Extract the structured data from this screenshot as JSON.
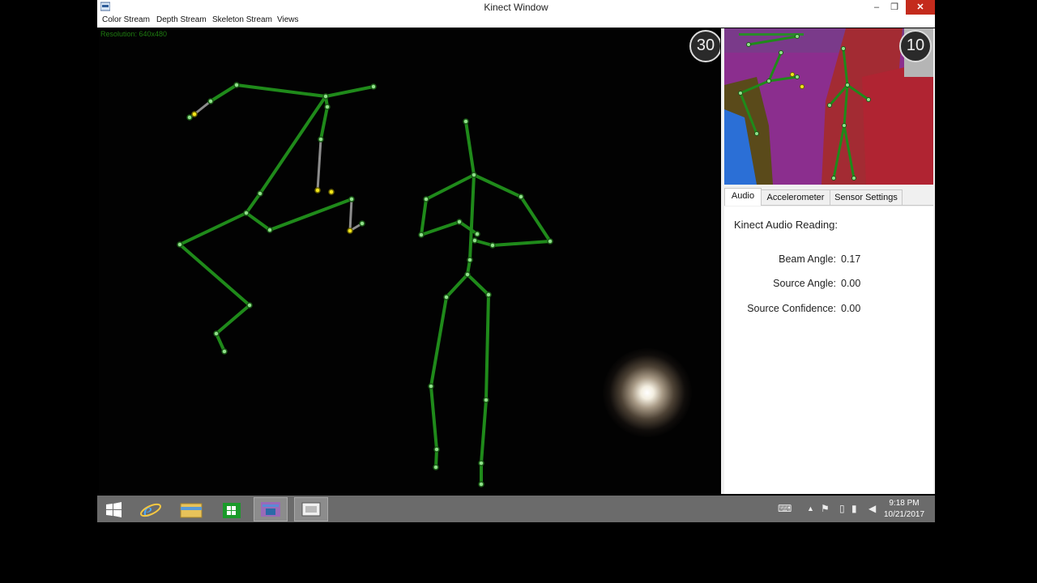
{
  "window": {
    "title": "Kinect Window",
    "minimize_glyph": "–",
    "maximize_glyph": "❒",
    "close_glyph": "✕"
  },
  "menu": {
    "items": [
      "Color Stream",
      "Depth Stream",
      "Skeleton Stream",
      "Views"
    ]
  },
  "stream": {
    "resolution_label": "Resolution: 640x480",
    "fps": "30"
  },
  "depth_view": {
    "fps": "10"
  },
  "tabs": {
    "items": [
      "Audio",
      "Accelerometer",
      "Sensor Settings"
    ],
    "active": "Audio"
  },
  "audio": {
    "heading": "Kinect Audio Reading:",
    "rows": [
      {
        "label": "Beam Angle:",
        "value": "0.17"
      },
      {
        "label": "Source Angle:",
        "value": "0.00"
      },
      {
        "label": "Source Confidence:",
        "value": "0.00"
      }
    ]
  },
  "taskbar": {
    "apps": [
      "start-icon",
      "internet-explorer-icon",
      "file-explorer-icon",
      "store-icon",
      "kinect-app-icon",
      "video-app-icon"
    ],
    "time": "9:18 PM",
    "date": "10/21/2017"
  },
  "colors": {
    "bone": "#1f8a1a",
    "inferred_bone": "#8c8c8c",
    "joint": "#8fe08a",
    "inferred_joint": "#f2e61a",
    "close_button": "#c42b1c"
  }
}
